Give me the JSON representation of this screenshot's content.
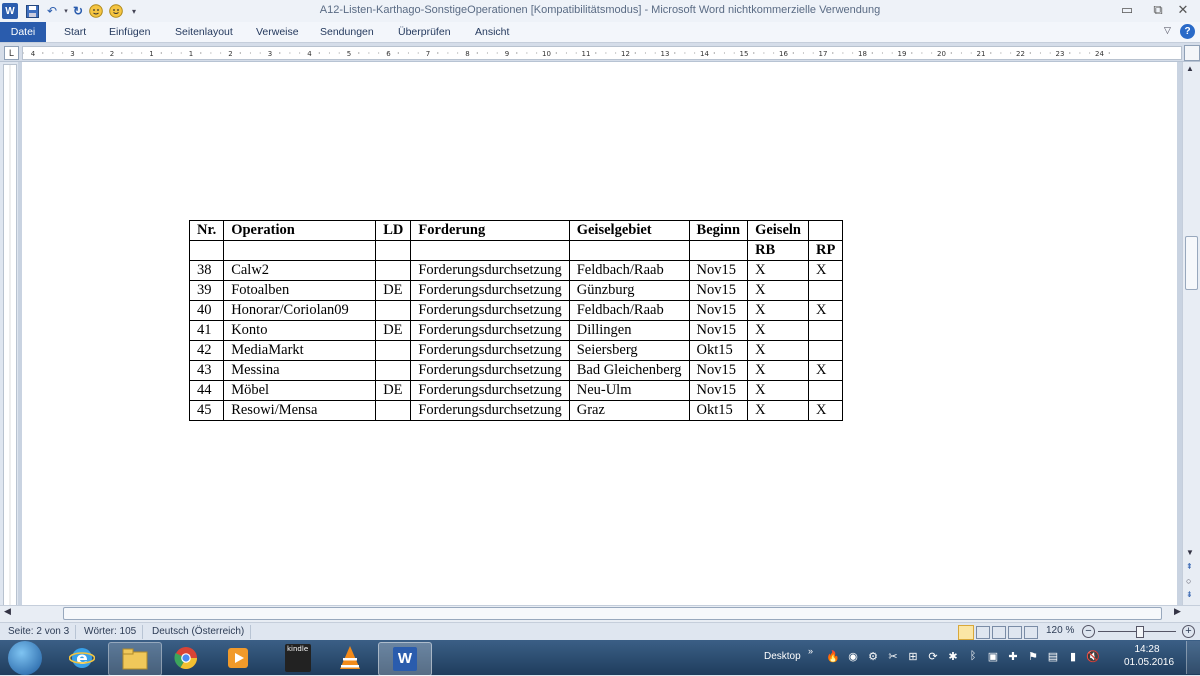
{
  "window": {
    "title": "A12-Listen-Karthago-SonstigeOperationen [Kompatibilitätsmodus]  -  Microsoft Word nichtkommerzielle Verwendung"
  },
  "ribbon": {
    "tabs": [
      "Datei",
      "Start",
      "Einfügen",
      "Seitenlayout",
      "Verweise",
      "Sendungen",
      "Überprüfen",
      "Ansicht"
    ]
  },
  "ruler": {
    "labels": [
      "4",
      "3",
      "2",
      "1",
      "1",
      "2",
      "3",
      "4",
      "5",
      "6",
      "7",
      "8",
      "9",
      "10",
      "11",
      "12",
      "13",
      "14",
      "15",
      "16",
      "17",
      "18",
      "19",
      "20",
      "21",
      "22",
      "23",
      "24"
    ]
  },
  "table": {
    "headers": [
      "Nr.",
      "Operation",
      "LD",
      "Forderung",
      "Geiselgebiet",
      "Beginn",
      "Geiseln",
      ""
    ],
    "subheaders": [
      "",
      "",
      "",
      "",
      "",
      "",
      "RB",
      "RP"
    ],
    "rows": [
      [
        "38",
        "Calw2",
        "",
        "Forderungsdurchsetzung",
        "Feldbach/Raab",
        "Nov15",
        "X",
        "X"
      ],
      [
        "39",
        "Fotoalben",
        "DE",
        "Forderungsdurchsetzung",
        "Günzburg",
        "Nov15",
        "X",
        ""
      ],
      [
        "40",
        "Honorar/Coriolan09",
        "",
        "Forderungsdurchsetzung",
        "Feldbach/Raab",
        "Nov15",
        "X",
        "X"
      ],
      [
        "41",
        "Konto",
        "DE",
        "Forderungsdurchsetzung",
        "Dillingen",
        "Nov15",
        "X",
        ""
      ],
      [
        "42",
        "MediaMarkt",
        "",
        "Forderungsdurchsetzung",
        "Seiersberg",
        "Okt15",
        "X",
        ""
      ],
      [
        "43",
        "Messina",
        "",
        "Forderungsdurchsetzung",
        "Bad Gleichenberg",
        "Nov15",
        "X",
        "X"
      ],
      [
        "44",
        "Möbel",
        "DE",
        "Forderungsdurchsetzung",
        "Neu-Ulm",
        "Nov15",
        "X",
        ""
      ],
      [
        "45",
        "Resowi/Mensa",
        "",
        "Forderungsdurchsetzung",
        "Graz",
        "Okt15",
        "X",
        "X"
      ]
    ]
  },
  "status": {
    "page": "Seite: 2 von 3",
    "words": "Wörter: 105",
    "language": "Deutsch (Österreich)",
    "zoom": "120 %"
  },
  "taskbar": {
    "desktop_label": "Desktop",
    "time": "14:28",
    "date": "01.05.2016",
    "kindle_label": "kindle"
  },
  "colors": {
    "file_tab": "#2a5cad",
    "taskbar": "#2b4a6e"
  }
}
